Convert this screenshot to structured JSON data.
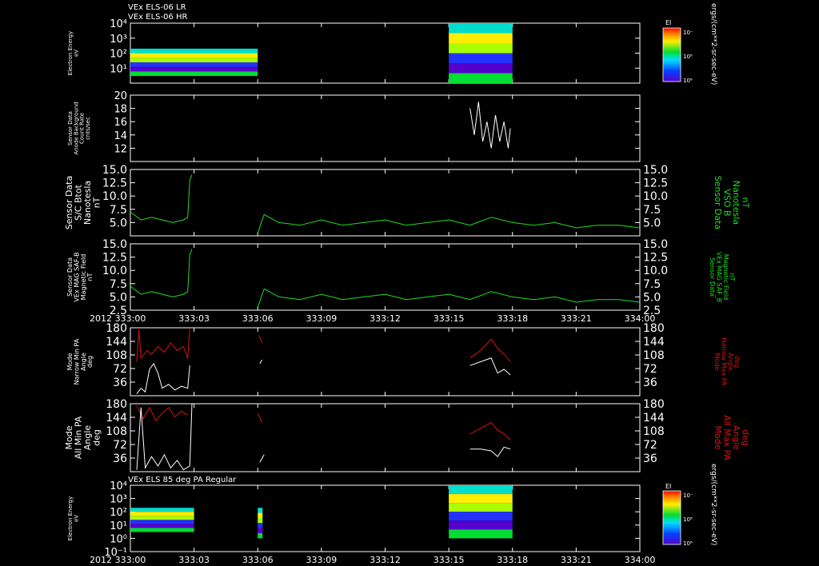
{
  "header": {
    "line1": "VEx ELS-06 LR",
    "line2": "VEx ELS-06 HR",
    "bottom_panel_title": "VEx ELS 85 deg PA Regular"
  },
  "colors": {
    "white": "#ffffff",
    "green": "#22dd22",
    "red": "#dd1111",
    "background": "#000000"
  },
  "time_axis": {
    "year_label": "2012",
    "ticks": [
      "333:00",
      "333:03",
      "333:06",
      "333:09",
      "333:12",
      "333:15",
      "333:18",
      "333:21",
      "334:00"
    ]
  },
  "colorbar": {
    "title": "EI",
    "ticks": [
      "10⁶",
      "10⁸",
      "10⁻"
    ],
    "unit_label": "ergs/(cm**2-sr-sec-eV)"
  },
  "chart_data": [
    {
      "type": "heatmap",
      "title": "VEx ELS-06 LR / VEx ELS-06 HR",
      "ylabel": [
        "Electron Energy",
        "eV"
      ],
      "yscale": "log",
      "ylim": [
        1,
        10000
      ],
      "y_ticks": [
        "10⁴",
        "10³",
        "10²",
        "10¹"
      ],
      "data_blocks": [
        {
          "x_range": [
            "333:00",
            "333:06"
          ],
          "energy_range_eV": [
            3,
            200
          ]
        },
        {
          "x_range": [
            "333:15",
            "333:18"
          ],
          "energy_range_eV": [
            1,
            10000
          ]
        }
      ]
    },
    {
      "type": "line",
      "ylabel": [
        "Sensor Data",
        "Anode Background",
        "Count Rate",
        "cnts/sec"
      ],
      "ylim": [
        10,
        20
      ],
      "y_ticks": [
        "20",
        "18",
        "16",
        "14",
        "12"
      ],
      "series": [
        {
          "color": "white",
          "x": [
            16.0,
            16.2,
            16.4,
            16.6,
            16.8,
            17.0,
            17.2,
            17.4,
            17.6,
            17.8,
            17.9
          ],
          "y": [
            18,
            14,
            19,
            13,
            16,
            12,
            17,
            13,
            16,
            12,
            15
          ]
        }
      ]
    },
    {
      "type": "line",
      "ylabel": [
        "Sensor Data",
        "S/C Btot",
        "Nanotesla",
        "nT"
      ],
      "right_label": [
        "Sensor Data",
        "VSO B",
        "Nanotesla",
        "nT"
      ],
      "ylim": [
        2.5,
        15
      ],
      "y_ticks": [
        "15.0",
        "12.5",
        "10.0",
        "7.5",
        "5.0"
      ],
      "series": [
        {
          "color": "green",
          "x": [
            0.0,
            0.5,
            1.0,
            1.5,
            2.0,
            2.5,
            2.7,
            2.8,
            2.9
          ],
          "y": [
            7.0,
            5.5,
            6.0,
            5.5,
            5.0,
            5.5,
            6.0,
            13.0,
            14.0
          ]
        },
        {
          "color": "green",
          "x": [
            6.0,
            6.3,
            7.0,
            8.0,
            9.0,
            10.0,
            11.0,
            12.0,
            13.0,
            14.0,
            15.0,
            16.0,
            17.0,
            18.0,
            19.0,
            20.0,
            21.0,
            22.0,
            23.0,
            24.0
          ],
          "y": [
            3.0,
            6.5,
            5.0,
            4.5,
            5.5,
            4.5,
            5.0,
            5.5,
            4.5,
            5.0,
            5.5,
            4.5,
            6.0,
            5.0,
            4.5,
            5.0,
            4.0,
            4.5,
            4.5,
            4.0
          ]
        }
      ]
    },
    {
      "type": "line",
      "ylabel": [
        "Sensor Data",
        "VEx MAG SAF-B",
        "Magnetic Field",
        "nT"
      ],
      "right_label": [
        "Sensor Data",
        "VEx MAG SAF_B",
        "Magnetic Field",
        "nT"
      ],
      "ylim": [
        2.5,
        15
      ],
      "y_ticks": [
        "15.0",
        "12.5",
        "10.0",
        "7.5",
        "5.0",
        "2.5"
      ],
      "series": [
        {
          "color": "green",
          "x": [
            0.0,
            0.5,
            1.0,
            1.5,
            2.0,
            2.5,
            2.7,
            2.8,
            2.9
          ],
          "y": [
            7.0,
            5.5,
            6.0,
            5.5,
            5.0,
            5.5,
            6.0,
            13.0,
            14.0
          ]
        },
        {
          "color": "green",
          "x": [
            6.0,
            6.3,
            7.0,
            8.0,
            9.0,
            10.0,
            11.0,
            12.0,
            13.0,
            14.0,
            15.0,
            16.0,
            17.0,
            18.0,
            19.0,
            20.0,
            21.0,
            22.0,
            23.0,
            24.0
          ],
          "y": [
            3.0,
            6.5,
            5.0,
            4.5,
            5.5,
            4.5,
            5.0,
            5.5,
            4.5,
            5.0,
            5.5,
            4.5,
            6.0,
            5.0,
            4.5,
            5.0,
            4.0,
            4.5,
            4.5,
            4.0
          ]
        }
      ]
    },
    {
      "type": "line",
      "ylabel": [
        "Mode",
        "Narrow Min PA",
        "Angle",
        "deg"
      ],
      "right_label": [
        "Mode",
        "Narrow Max PA",
        "Angle",
        "deg"
      ],
      "ylim": [
        0,
        180
      ],
      "y_ticks": [
        "180",
        "144",
        "108",
        "72",
        "36"
      ],
      "series": [
        {
          "color": "red",
          "x": [
            0.3,
            0.4,
            0.5,
            0.8,
            1.0,
            1.3,
            1.6,
            1.9,
            2.2,
            2.5,
            2.7,
            2.8
          ],
          "y": [
            90,
            175,
            100,
            120,
            110,
            130,
            115,
            140,
            120,
            130,
            100,
            180
          ]
        },
        {
          "color": "white",
          "x": [
            0.3,
            0.5,
            0.7,
            0.9,
            1.1,
            1.3,
            1.5,
            1.8,
            2.1,
            2.4,
            2.7,
            2.8
          ],
          "y": [
            5,
            20,
            10,
            70,
            85,
            60,
            20,
            30,
            15,
            25,
            20,
            80
          ]
        },
        {
          "color": "red",
          "x": [
            6.05,
            6.2
          ],
          "y": [
            160,
            140
          ]
        },
        {
          "color": "white",
          "x": [
            6.1,
            6.2
          ],
          "y": [
            85,
            95
          ]
        },
        {
          "color": "red",
          "x": [
            16.0,
            16.5,
            17.0,
            17.3,
            17.6,
            17.9
          ],
          "y": [
            100,
            120,
            150,
            125,
            110,
            90
          ]
        },
        {
          "color": "white",
          "x": [
            16.0,
            16.5,
            17.0,
            17.3,
            17.6,
            17.9
          ],
          "y": [
            80,
            90,
            100,
            60,
            70,
            55
          ]
        }
      ]
    },
    {
      "type": "line",
      "ylabel": [
        "Mode",
        "All Min PA",
        "Angle",
        "deg"
      ],
      "right_label": [
        "Mode",
        "All Max PA",
        "Angle",
        "deg"
      ],
      "ylim": [
        0,
        180
      ],
      "y_ticks": [
        "180",
        "144",
        "108",
        "72",
        "36"
      ],
      "series": [
        {
          "color": "red",
          "x": [
            0.3,
            0.6,
            0.9,
            1.2,
            1.5,
            1.8,
            2.1,
            2.4,
            2.7
          ],
          "y": [
            175,
            140,
            170,
            135,
            155,
            170,
            145,
            160,
            150
          ]
        },
        {
          "color": "white",
          "x": [
            0.3,
            0.5,
            0.7,
            1.0,
            1.3,
            1.6,
            1.9,
            2.2,
            2.5,
            2.8,
            2.9
          ],
          "y": [
            5,
            170,
            10,
            40,
            15,
            45,
            10,
            30,
            5,
            15,
            180
          ]
        },
        {
          "color": "red",
          "x": [
            6.0,
            6.2
          ],
          "y": [
            155,
            130
          ]
        },
        {
          "color": "white",
          "x": [
            6.1,
            6.3
          ],
          "y": [
            25,
            45
          ]
        },
        {
          "color": "red",
          "x": [
            16.0,
            16.5,
            17.0,
            17.3,
            17.6,
            17.9
          ],
          "y": [
            100,
            115,
            130,
            110,
            100,
            85
          ]
        },
        {
          "color": "white",
          "x": [
            16.0,
            16.5,
            17.0,
            17.3,
            17.6,
            17.9
          ],
          "y": [
            60,
            60,
            55,
            40,
            65,
            60
          ]
        }
      ]
    },
    {
      "type": "heatmap",
      "title": "VEx ELS 85 deg PA Regular",
      "ylabel": [
        "Electron Energy",
        "eV"
      ],
      "yscale": "log",
      "ylim": [
        0.1,
        10000
      ],
      "y_ticks": [
        "10⁴",
        "10³",
        "10²",
        "10¹",
        "10⁰",
        "10⁻¹"
      ],
      "data_blocks": [
        {
          "x_range": [
            "333:00",
            "333:03"
          ],
          "energy_range_eV": [
            3,
            200
          ]
        },
        {
          "x_range": [
            "333:06",
            "333:06"
          ],
          "energy_range_eV": [
            1,
            200
          ]
        },
        {
          "x_range": [
            "333:15",
            "333:18"
          ],
          "energy_range_eV": [
            1,
            10000
          ]
        }
      ]
    }
  ]
}
